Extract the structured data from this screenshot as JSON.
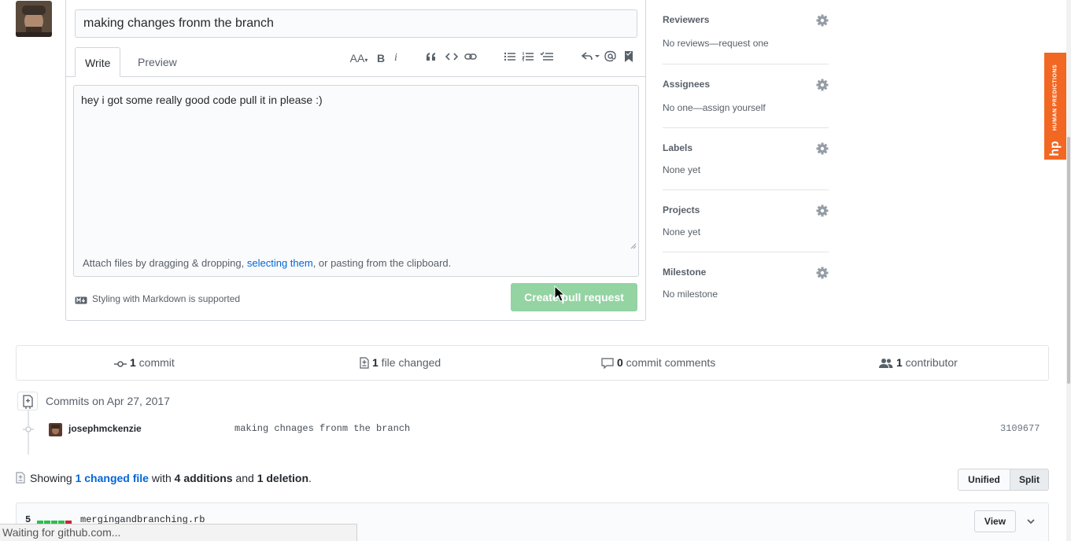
{
  "pr_form": {
    "title_value": "making changes fronm the branch",
    "tabs": {
      "write": "Write",
      "preview": "Preview"
    },
    "toolbar": {
      "header": "AA",
      "bold": "B",
      "italic": "i"
    },
    "body_value": "hey i got some really good code pull it in please :)",
    "attach": {
      "prefix": "Attach files by dragging & dropping, ",
      "link": "selecting them",
      "suffix": ", or pasting from the clipboard."
    },
    "markdown_note": "Styling with Markdown is supported",
    "create_button": "Create pull request"
  },
  "sidebar": {
    "reviewers": {
      "title": "Reviewers",
      "value": "No reviews—request one"
    },
    "assignees": {
      "title": "Assignees",
      "value": "No one—assign yourself"
    },
    "labels": {
      "title": "Labels",
      "value": "None yet"
    },
    "projects": {
      "title": "Projects",
      "value": "None yet"
    },
    "milestone": {
      "title": "Milestone",
      "value": "No milestone"
    }
  },
  "hp_badge": {
    "text": "HUMAN PREDICTIONS",
    "logo": "hp",
    "color": "#f26722"
  },
  "stats": {
    "commits": {
      "count": "1",
      "label": " commit"
    },
    "files": {
      "count": "1",
      "label": " file changed"
    },
    "comments": {
      "count": "0",
      "label": " commit comments"
    },
    "contributors": {
      "count": "1",
      "label": " contributor"
    }
  },
  "commits": {
    "date_heading": "Commits on Apr 27, 2017",
    "items": [
      {
        "author": "josephmckenzie",
        "message": "making chnages fronm the branch",
        "sha": "3109677"
      }
    ]
  },
  "diff_summary": {
    "prefix": "Showing ",
    "link": "1 changed file",
    "middle": " with ",
    "additions": "4 additions",
    "and": " and ",
    "deletions": "1 deletion",
    "suffix": ".",
    "unified": "Unified",
    "split": "Split"
  },
  "file": {
    "change_count": "5",
    "diffstat": [
      "added",
      "added",
      "added",
      "added",
      "deleted"
    ],
    "name": "mergingandbranching.rb",
    "view_button": "View"
  },
  "browser_status": "Waiting for github.com...",
  "colors": {
    "link": "#0366d6",
    "create_button_disabled": "#94d3a2",
    "added": "#2cbe4e",
    "deleted": "#cb2431"
  }
}
